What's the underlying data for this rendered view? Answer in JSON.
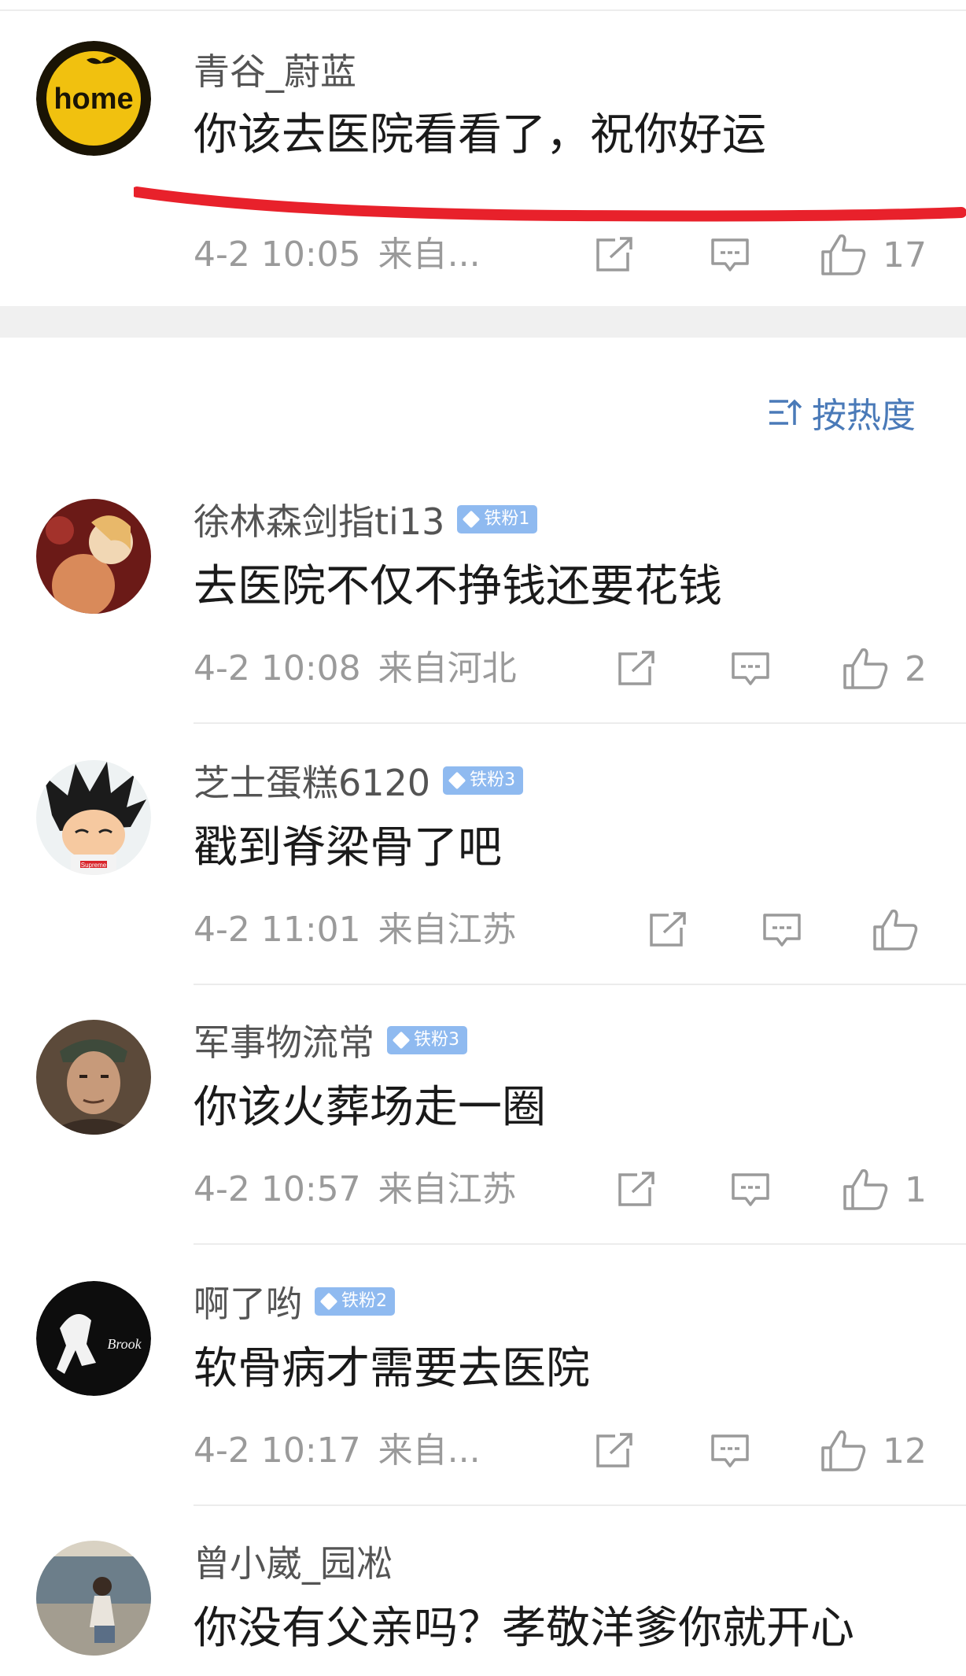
{
  "sort": {
    "label": "按热度",
    "icon": "sort-icon"
  },
  "comments": [
    {
      "username": "青谷_蔚蓝",
      "badge": "",
      "text": "你该去医院看看了，祝你好运",
      "date": "4-2 10:05",
      "source": "来自...",
      "likes": "17",
      "avatar_text": "home"
    },
    {
      "username": "徐林森剑指ti13",
      "badge": "铁粉1",
      "text": "去医院不仅不挣钱还要花钱",
      "date": "4-2 10:08",
      "source": "来自河北",
      "likes": "2"
    },
    {
      "username": "芝士蛋糕6120",
      "badge": "铁粉3",
      "text": "戳到脊梁骨了吧",
      "date": "4-2 11:01",
      "source": "来自江苏",
      "likes": "",
      "avatar_text": "Supreme"
    },
    {
      "username": "军事物流常",
      "badge": "铁粉3",
      "text": "你该火葬场走一圈",
      "date": "4-2 10:57",
      "source": "来自江苏",
      "likes": "1"
    },
    {
      "username": "啊了哟",
      "badge": "铁粉2",
      "text": "软骨病才需要去医院",
      "date": "4-2 10:17",
      "source": "来自...",
      "likes": "12",
      "avatar_text": "Brook"
    },
    {
      "username": "曾小崴_园凇",
      "badge": "",
      "text": "你没有父亲吗？孝敬洋爹你就开心",
      "date": "",
      "source": "",
      "likes": ""
    }
  ],
  "icons": {
    "repost": "repost-icon",
    "comment": "comment-icon",
    "like": "like-icon"
  },
  "colors": {
    "annotation_red": "#e8212b",
    "link_blue": "#4a7ab8",
    "badge_blue": "#8fbaf0"
  }
}
